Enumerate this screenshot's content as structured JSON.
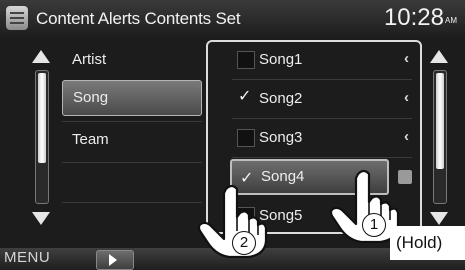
{
  "header": {
    "title": "Content Alerts Contents Set",
    "time": "10:28",
    "time_suffix": "AM"
  },
  "categories": [
    {
      "label": "Artist",
      "selected": false
    },
    {
      "label": "Song",
      "selected": true
    },
    {
      "label": "Team",
      "selected": false
    }
  ],
  "songs": [
    {
      "label": "Song1",
      "checked": false,
      "check": ""
    },
    {
      "label": "Song2",
      "checked": true,
      "check": "✓"
    },
    {
      "label": "Song3",
      "checked": false,
      "check": ""
    },
    {
      "label": "Song4",
      "checked": true,
      "check": "✓"
    },
    {
      "label": "Song5",
      "checked": false,
      "check": ""
    }
  ],
  "chevron": "‹",
  "footer": {
    "menu_label": "MENU"
  },
  "annotations": {
    "step1": "1",
    "step2": "2",
    "hold": "(Hold)"
  },
  "colors": {
    "background": "#1c1c1c",
    "selected": "#5a5a5a",
    "frame": "#dcdcdc"
  }
}
